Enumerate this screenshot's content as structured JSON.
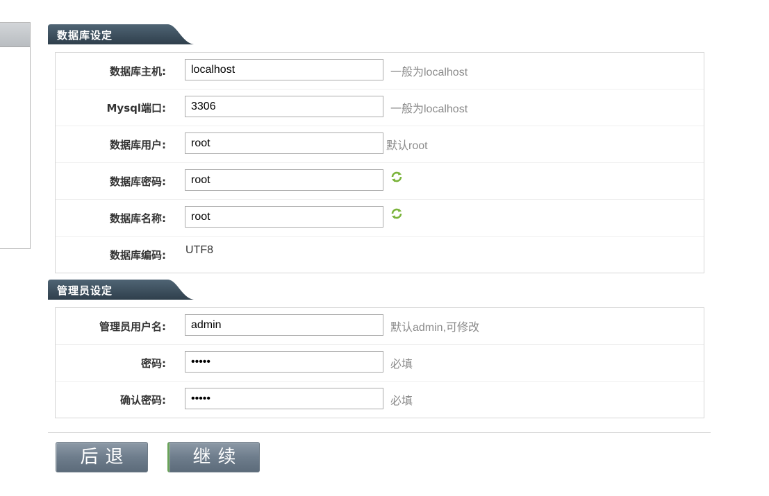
{
  "db_section": {
    "title": "数据库设定",
    "rows": {
      "host": {
        "label": "数据库主机:",
        "value": "localhost",
        "hint": "一般为localhost"
      },
      "port": {
        "label": "Mysql端口:",
        "value": "3306",
        "hint": "一般为localhost"
      },
      "user": {
        "label": "数据库用户:",
        "value": "root",
        "hint": "默认root"
      },
      "password": {
        "label": "数据库密码:",
        "value": "root"
      },
      "name": {
        "label": "数据库名称:",
        "value": "root"
      },
      "charset": {
        "label": "数据库编码:",
        "value": "UTF8"
      }
    }
  },
  "admin_section": {
    "title": "管理员设定",
    "rows": {
      "username": {
        "label": "管理员用户名:",
        "value": "admin",
        "hint": "默认admin,可修改"
      },
      "password": {
        "label": "密码:",
        "value": "admin",
        "hint": "必填"
      },
      "confirm": {
        "label": "确认密码:",
        "value": "admin",
        "hint": "必填"
      }
    }
  },
  "buttons": {
    "back": "后退",
    "next": "继续"
  },
  "icons": {
    "refresh": "refresh-icon"
  },
  "colors": {
    "tab_bg": "#3f5262",
    "refresh_green": "#7ab33a",
    "button_bg": "#6e7d8c"
  }
}
